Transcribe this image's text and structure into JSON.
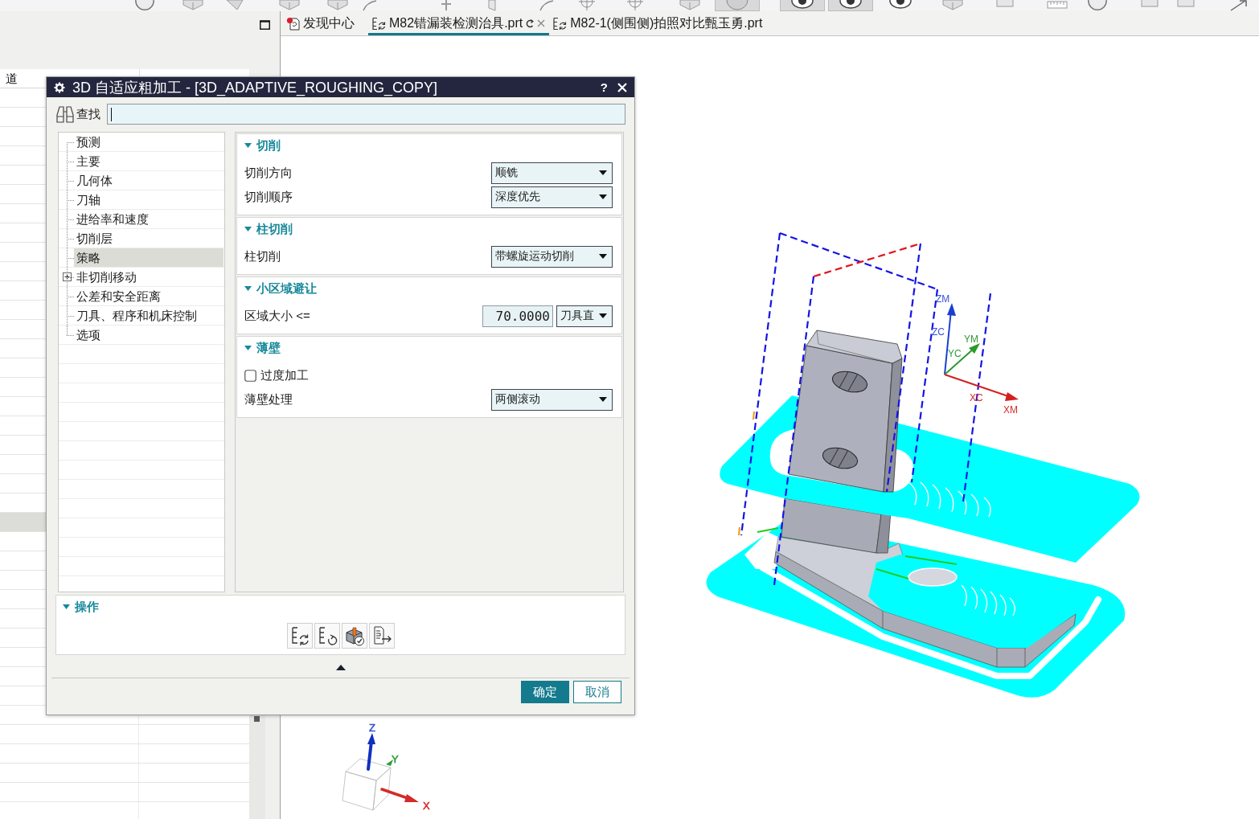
{
  "toolbar": [
    {
      "on": false
    },
    {
      "on": false
    },
    {
      "on": false
    },
    {
      "on": false
    },
    {
      "on": false
    },
    {
      "on": false
    },
    {
      "on": false
    },
    {
      "on": false
    },
    {
      "on": false
    },
    {
      "on": false
    },
    {
      "on": false
    },
    {
      "on": false
    },
    {
      "on": true
    },
    {
      "on": true
    },
    {
      "on": true
    },
    {
      "on": false
    },
    {
      "on": false
    },
    {
      "on": false
    },
    {
      "on": false
    },
    {
      "on": false
    },
    {
      "on": false
    },
    {
      "on": false
    },
    {
      "on": false
    }
  ],
  "tabs": [
    {
      "kind": "discovery",
      "label": "发现中心",
      "selected": false
    },
    {
      "kind": "part",
      "label": "M82错漏装检测治具.prt",
      "selected": true
    },
    {
      "kind": "part",
      "label": "M82-1(侧围侧)拍照对比甄玉勇.prt",
      "selected": false
    }
  ],
  "left_panel": {
    "columns": [
      "道"
    ],
    "rows": [
      {
        "selected": false
      },
      {
        "selected": false
      },
      {
        "selected": false
      },
      {
        "selected": false
      },
      {
        "selected": false
      },
      {
        "selected": false
      },
      {
        "selected": false
      },
      {
        "selected": false
      },
      {
        "selected": false
      },
      {
        "selected": false
      },
      {
        "selected": false
      },
      {
        "selected": false
      },
      {
        "selected": false
      },
      {
        "selected": false
      },
      {
        "selected": false
      },
      {
        "selected": false
      },
      {
        "selected": false
      },
      {
        "selected": false
      },
      {
        "selected": false
      },
      {
        "selected": false
      },
      {
        "selected": false
      },
      {
        "selected": false
      },
      {
        "selected": true
      },
      {
        "selected": false
      },
      {
        "selected": false
      },
      {
        "selected": false
      },
      {
        "selected": false
      },
      {
        "selected": false
      },
      {
        "selected": false
      },
      {
        "selected": false
      },
      {
        "selected": false
      },
      {
        "selected": false
      },
      {
        "selected": false
      },
      {
        "selected": false
      },
      {
        "selected": false
      },
      {
        "selected": false
      },
      {
        "selected": false
      },
      {
        "selected": false
      }
    ]
  },
  "dialog": {
    "title": "3D 自适应粗加工 - [3D_ADAPTIVE_ROUGHING_COPY]",
    "help": "?",
    "search": {
      "label": "查找"
    },
    "tree": [
      {
        "label": "预测",
        "selected": false
      },
      {
        "label": "主要",
        "selected": false
      },
      {
        "label": "几何体",
        "selected": false
      },
      {
        "label": "刀轴",
        "selected": false
      },
      {
        "label": "进给率和速度",
        "selected": false
      },
      {
        "label": "切削层",
        "selected": false
      },
      {
        "label": "策略",
        "selected": true
      },
      {
        "label": "非切削移动",
        "selected": false,
        "expanded": false
      },
      {
        "label": "公差和安全距离",
        "selected": false
      },
      {
        "label": "刀具、程序和机床控制",
        "selected": false
      },
      {
        "label": "选项",
        "selected": false
      }
    ],
    "groups": [
      {
        "title": "切削",
        "expanded": true,
        "rows": [
          {
            "kind": "dropdown",
            "label": "切削方向",
            "value": "顺铣"
          },
          {
            "kind": "dropdown",
            "label": "切削顺序",
            "value": "深度优先"
          }
        ]
      },
      {
        "title": "柱切削",
        "expanded": true,
        "rows": [
          {
            "kind": "dropdown",
            "label": "柱切削",
            "value": "带螺旋运动切削"
          }
        ]
      },
      {
        "title": "小区域避让",
        "expanded": true,
        "rows": [
          {
            "kind": "number",
            "label": "区域大小 <=",
            "value": "70.0000",
            "unit": "刀具直"
          }
        ]
      },
      {
        "title": "薄壁",
        "expanded": true,
        "rows": [
          {
            "kind": "checkbox",
            "label": "过度加工",
            "checked": false
          },
          {
            "kind": "dropdown",
            "label": "薄壁处理",
            "value": "两侧滚动"
          }
        ]
      }
    ],
    "operations": {
      "title": "操作",
      "expanded": true
    },
    "buttons": [
      {
        "kind": "primary",
        "label": "确定"
      },
      {
        "kind": "secondary",
        "label": "取消"
      }
    ]
  },
  "viewport": {
    "work_axes": [
      {
        "label": "ZM",
        "color": "#3352d8"
      },
      {
        "label": "ZC",
        "color": "#3352d8"
      },
      {
        "label": "YM",
        "color": "#2f9a36"
      },
      {
        "label": "YC",
        "color": "#2f9a36"
      },
      {
        "label": "XC",
        "color": "#d42a2a"
      },
      {
        "label": "XM",
        "color": "#d42a2a"
      }
    ],
    "view_triad": [
      {
        "label": "Z",
        "color": "#3352d8"
      },
      {
        "label": "Y",
        "color": "#2f9a36"
      },
      {
        "label": "X",
        "color": "#d42a2a"
      }
    ]
  }
}
